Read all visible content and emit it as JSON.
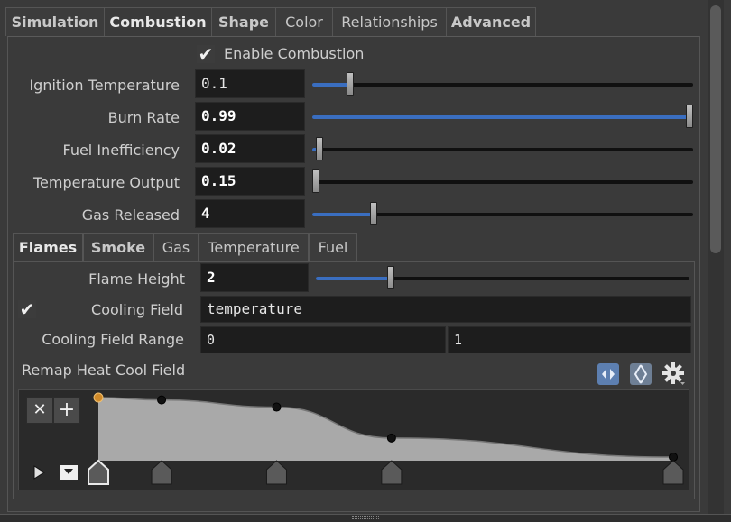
{
  "tabs": [
    {
      "label": "Simulation",
      "bold": true
    },
    {
      "label": "Combustion",
      "bold": true,
      "active": true
    },
    {
      "label": "Shape",
      "bold": true
    },
    {
      "label": "Color"
    },
    {
      "label": "Relationships"
    },
    {
      "label": "Advanced",
      "bold": true
    }
  ],
  "enable_combustion": {
    "label": "Enable Combustion",
    "checked": true
  },
  "params": {
    "ignition": {
      "label": "Ignition Temperature",
      "value": "0.1",
      "fill": 0.1
    },
    "burn_rate": {
      "label": "Burn Rate",
      "value": "0.99",
      "fill": 0.99
    },
    "fuel_ineff": {
      "label": "Fuel Inefficiency",
      "value": "0.02",
      "fill": 0.02
    },
    "temp_output": {
      "label": "Temperature Output",
      "value": "0.15",
      "fill": 0.01
    },
    "gas_released": {
      "label": "Gas Released",
      "value": "4",
      "fill": 0.16
    }
  },
  "subtabs": [
    {
      "label": "Flames",
      "bold": true,
      "active": true
    },
    {
      "label": "Smoke",
      "bold": true
    },
    {
      "label": "Gas"
    },
    {
      "label": "Temperature"
    },
    {
      "label": "Fuel"
    }
  ],
  "flames": {
    "flame_height": {
      "label": "Flame Height",
      "value": "2",
      "fill": 0.2
    },
    "cooling_field": {
      "label": "Cooling Field",
      "value": "temperature",
      "checked": true
    },
    "cooling_range": {
      "label": "Cooling Field Range",
      "min": "0",
      "max": "1"
    },
    "remap": {
      "label": "Remap Heat Cool Field"
    }
  },
  "ramp": {
    "points": [
      {
        "pos": 0.0,
        "value": 1.0
      },
      {
        "pos": 0.11,
        "value": 0.96
      },
      {
        "pos": 0.31,
        "value": 0.84
      },
      {
        "pos": 0.51,
        "value": 0.32
      },
      {
        "pos": 1.0,
        "value": 0.0
      }
    ]
  },
  "colors": {
    "accent": "#3a6ec0",
    "selected_point": "#d08a2a"
  }
}
